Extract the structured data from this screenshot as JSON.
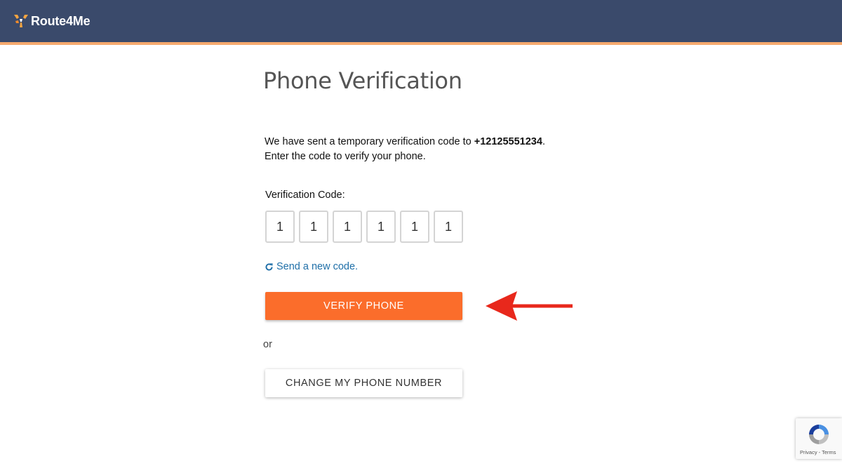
{
  "header": {
    "logo_text": "Route4Me",
    "logo_icon": "route4me-logo-icon",
    "bg_color": "#3a4a6b",
    "accent_color": "#f6a96e"
  },
  "main": {
    "title": "Phone Verification",
    "message_prefix": "We have sent a temporary verification code to ",
    "phone_number": "+12125551234",
    "message_suffix": ".",
    "message_line2": "Enter the code to verify your phone.",
    "code_label": "Verification Code:",
    "code_digits": [
      "1",
      "1",
      "1",
      "1",
      "1",
      "1"
    ],
    "resend_icon": "refresh-icon",
    "resend_label": "Send a new code.",
    "verify_button_label": "VERIFY PHONE",
    "verify_button_color": "#fb6d2b",
    "annotation_arrow_color": "#e8281c",
    "or_text": "or",
    "change_button_label": "CHANGE MY PHONE NUMBER"
  },
  "recaptcha": {
    "icon": "recaptcha-icon",
    "text": "Privacy - Terms"
  }
}
